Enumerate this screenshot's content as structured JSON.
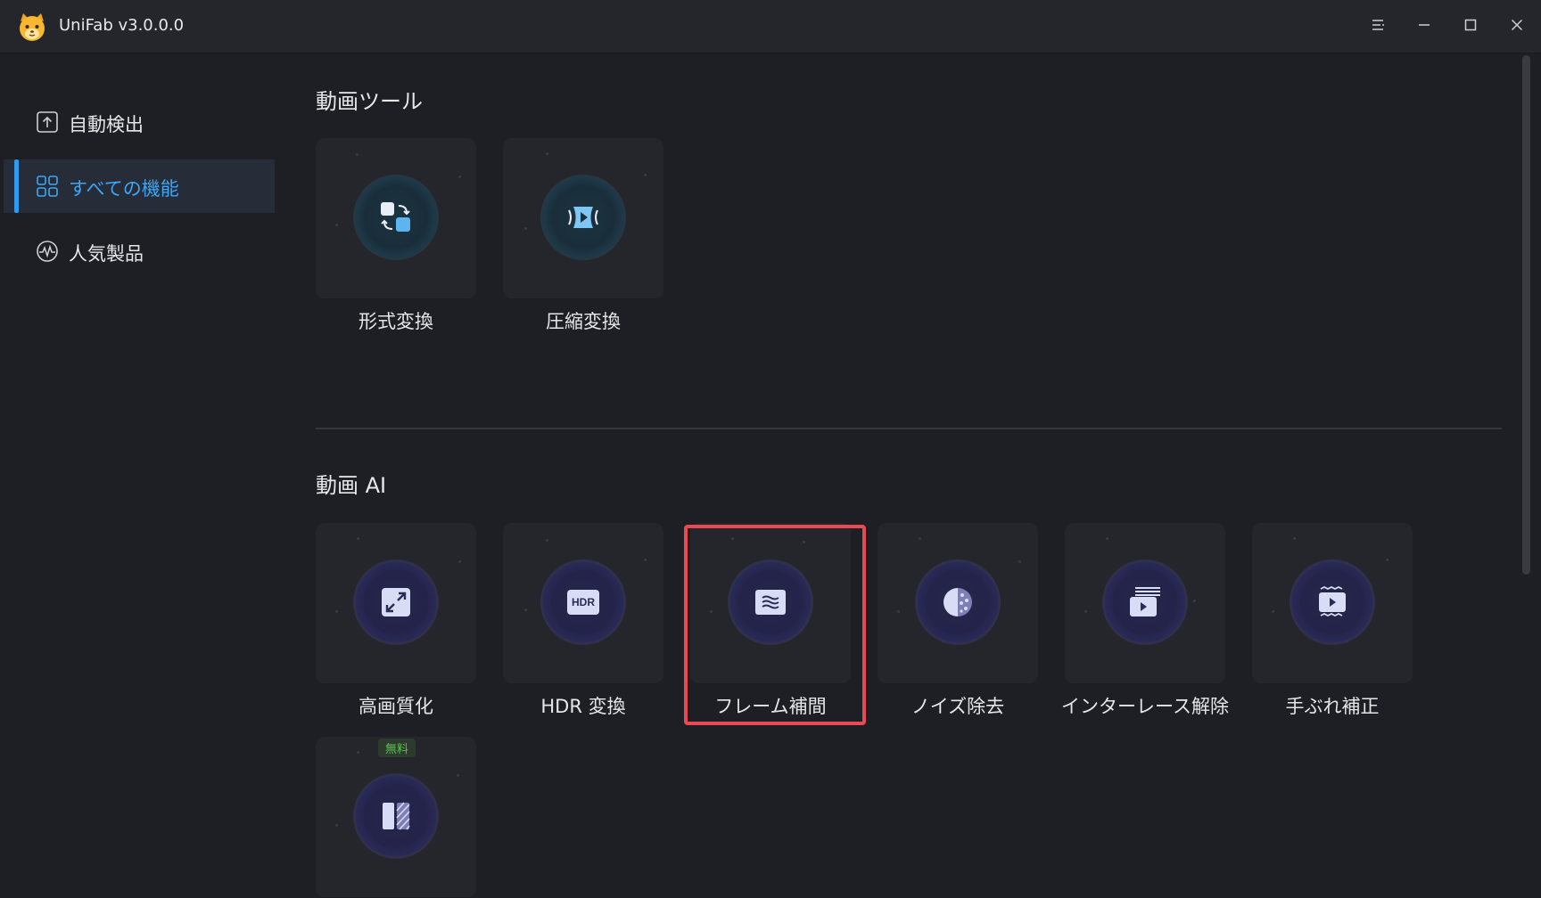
{
  "app": {
    "title": "UniFab v3.0.0.0"
  },
  "window_controls": {
    "menu_icon": "menu-icon",
    "minimize_icon": "minimize-icon",
    "maximize_icon": "maximize-icon",
    "close_icon": "close-icon"
  },
  "sidebar": {
    "items": [
      {
        "label": "自動検出",
        "icon": "upload-box-icon",
        "active": false
      },
      {
        "label": "すべての機能",
        "icon": "grid-icon",
        "active": true
      },
      {
        "label": "人気製品",
        "icon": "trending-icon",
        "active": false
      }
    ]
  },
  "sections": [
    {
      "title": "動画ツール",
      "cards": [
        {
          "label": "形式変換",
          "icon": "format-convert-icon"
        },
        {
          "label": "圧縮変換",
          "icon": "compress-video-icon"
        }
      ]
    },
    {
      "title": "動画 AI",
      "cards": [
        {
          "label": "高画質化",
          "icon": "upscale-icon"
        },
        {
          "label": "HDR 変換",
          "icon": "hdr-icon",
          "icon_text": "HDR"
        },
        {
          "label": "フレーム補間",
          "icon": "frame-interpolation-icon",
          "highlighted": true
        },
        {
          "label": "ノイズ除去",
          "icon": "denoise-icon"
        },
        {
          "label": "インターレース解除",
          "icon": "deinterlace-icon"
        },
        {
          "label": "手ぶれ補正",
          "icon": "stabilize-icon"
        },
        {
          "label": "",
          "icon": "compare-icon",
          "badge": "無料"
        }
      ]
    }
  ],
  "colors": {
    "accent": "#2f9bf0",
    "highlight_border": "#e74a55",
    "badge_text": "#52c44a"
  }
}
